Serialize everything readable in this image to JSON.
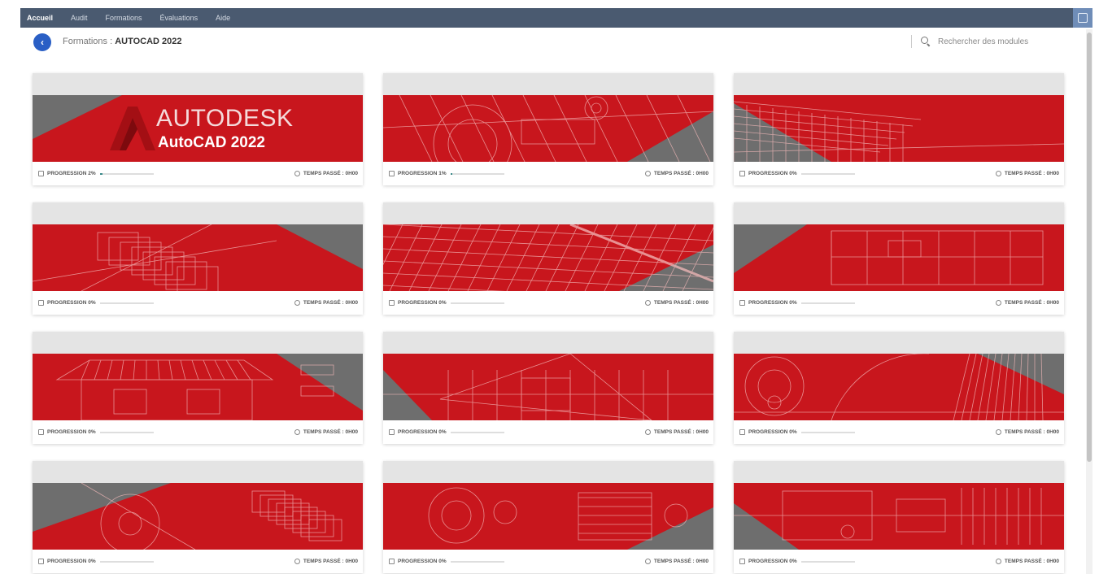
{
  "nav": {
    "items": [
      {
        "label": "Accueil",
        "active": true
      },
      {
        "label": "Audit",
        "active": false
      },
      {
        "label": "Formations",
        "active": false
      },
      {
        "label": "Évaluations",
        "active": false
      },
      {
        "label": "Aide",
        "active": false
      }
    ]
  },
  "header": {
    "breadcrumb_prefix": "Formations : ",
    "breadcrumb_current": "AUTOCAD 2022",
    "search_placeholder": "Rechercher des modules"
  },
  "footer_labels": {
    "progress": "PROGRESSION",
    "time": "TEMPS PASSÉ :"
  },
  "cards": [
    {
      "title": "",
      "progress_text": "2%",
      "progress": 0.05,
      "time": "0h00",
      "banner": "logo",
      "icon": "book-icon"
    },
    {
      "title": "",
      "progress_text": "1%",
      "progress": 0.03,
      "time": "0h00",
      "banner": "mech",
      "icon": "book-icon"
    },
    {
      "title": "",
      "progress_text": "0%",
      "progress": 0.0,
      "time": "0h00",
      "banner": "building",
      "icon": "book-icon"
    },
    {
      "title": "",
      "progress_text": "0%",
      "progress": 0.0,
      "time": "0h00",
      "banner": "house3d",
      "icon": "book-icon"
    },
    {
      "title": "",
      "progress_text": "0%",
      "progress": 0.0,
      "time": "0h00",
      "banner": "map",
      "icon": "book-icon"
    },
    {
      "title": "",
      "progress_text": "0%",
      "progress": 0.0,
      "time": "0h00",
      "banner": "plan",
      "icon": "book-icon"
    },
    {
      "title": "",
      "progress_text": "0%",
      "progress": 0.0,
      "time": "0h00",
      "banner": "house",
      "icon": "book-icon"
    },
    {
      "title": "",
      "progress_text": "0%",
      "progress": 0.0,
      "time": "0h00",
      "banner": "section",
      "icon": "book-icon"
    },
    {
      "title": "",
      "progress_text": "0%",
      "progress": 0.0,
      "time": "0h00",
      "banner": "gears",
      "icon": "book-icon"
    },
    {
      "title": "",
      "progress_text": "0%",
      "progress": 0.0,
      "time": "0h00",
      "banner": "engine",
      "icon": "book-icon"
    },
    {
      "title": "",
      "progress_text": "0%",
      "progress": 0.0,
      "time": "0h00",
      "banner": "gears2",
      "icon": "book-icon"
    },
    {
      "title": "",
      "progress_text": "0%",
      "progress": 0.0,
      "time": "0h00",
      "banner": "plan2",
      "icon": "book-icon"
    }
  ],
  "logo": {
    "brand": "AUTODESK",
    "product": "AutoCAD 2022"
  },
  "colors": {
    "topbar": "#4a5a70",
    "banner_red": "#c8161d",
    "banner_grey": "#6e6e6e",
    "accent_blue": "#2a5fc5",
    "progress_fill": "#3a8a8a"
  }
}
